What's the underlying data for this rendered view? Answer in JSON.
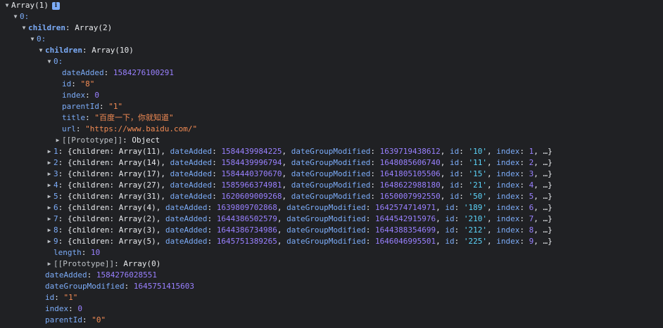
{
  "colors": {
    "background": "#202124",
    "key": "#7cacf8",
    "number": "#9980ff",
    "string": "#f28b54",
    "text": "#e8eaed",
    "info_badge": "#7cacf8"
  },
  "info_icon": "info-icon",
  "lines": [
    {
      "indent": 0,
      "arrow": "expanded",
      "clickable": true,
      "parts": [
        {
          "t": "plain",
          "v": "Array(1)"
        }
      ],
      "badge": "i"
    },
    {
      "indent": 1,
      "arrow": "expanded",
      "clickable": true,
      "parts": [
        {
          "t": "key",
          "v": "0:"
        }
      ]
    },
    {
      "indent": 2,
      "arrow": "expanded",
      "clickable": true,
      "parts": [
        {
          "t": "keyb",
          "v": "children"
        },
        {
          "t": "plain",
          "v": ": Array(2)"
        }
      ]
    },
    {
      "indent": 3,
      "arrow": "expanded",
      "clickable": true,
      "parts": [
        {
          "t": "key",
          "v": "0:"
        }
      ]
    },
    {
      "indent": 4,
      "arrow": "expanded",
      "clickable": true,
      "parts": [
        {
          "t": "keyb",
          "v": "children"
        },
        {
          "t": "plain",
          "v": ": Array(10)"
        }
      ]
    },
    {
      "indent": 5,
      "arrow": "expanded",
      "clickable": true,
      "parts": [
        {
          "t": "key",
          "v": "0:"
        }
      ]
    },
    {
      "indent": 6,
      "arrow": "none",
      "clickable": false,
      "parts": [
        {
          "t": "key",
          "v": "dateAdded"
        },
        {
          "t": "plain",
          "v": ": "
        },
        {
          "t": "num",
          "v": "1584276100291"
        }
      ]
    },
    {
      "indent": 6,
      "arrow": "none",
      "clickable": false,
      "parts": [
        {
          "t": "key",
          "v": "id"
        },
        {
          "t": "plain",
          "v": ": "
        },
        {
          "t": "str",
          "v": "\"8\""
        }
      ]
    },
    {
      "indent": 6,
      "arrow": "none",
      "clickable": false,
      "parts": [
        {
          "t": "key",
          "v": "index"
        },
        {
          "t": "plain",
          "v": ": "
        },
        {
          "t": "num",
          "v": "0"
        }
      ]
    },
    {
      "indent": 6,
      "arrow": "none",
      "clickable": false,
      "parts": [
        {
          "t": "key",
          "v": "parentId"
        },
        {
          "t": "plain",
          "v": ": "
        },
        {
          "t": "str",
          "v": "\"1\""
        }
      ]
    },
    {
      "indent": 6,
      "arrow": "none",
      "clickable": false,
      "parts": [
        {
          "t": "key",
          "v": "title"
        },
        {
          "t": "plain",
          "v": ": "
        },
        {
          "t": "str",
          "v": "\"百度一下，你就知道\""
        }
      ]
    },
    {
      "indent": 6,
      "arrow": "none",
      "clickable": false,
      "parts": [
        {
          "t": "key",
          "v": "url"
        },
        {
          "t": "plain",
          "v": ": "
        },
        {
          "t": "str",
          "v": "\"https://www.baidu.com/\""
        }
      ]
    },
    {
      "indent": 6,
      "arrow": "collapsed",
      "clickable": true,
      "parts": [
        {
          "t": "proto",
          "v": "[[Prototype]]"
        },
        {
          "t": "plain",
          "v": ": Object"
        }
      ]
    },
    {
      "indent": 5,
      "arrow": "collapsed",
      "clickable": true,
      "parts": [
        {
          "t": "key",
          "v": "1"
        },
        {
          "t": "plain",
          "v": ": {children: Array(11), "
        },
        {
          "t": "key",
          "v": "dateAdded"
        },
        {
          "t": "plain",
          "v": ": "
        },
        {
          "t": "num",
          "v": "1584439984225"
        },
        {
          "t": "plain",
          "v": ", "
        },
        {
          "t": "key",
          "v": "dateGroupModified"
        },
        {
          "t": "plain",
          "v": ": "
        },
        {
          "t": "num",
          "v": "1639719438612"
        },
        {
          "t": "plain",
          "v": ", "
        },
        {
          "t": "key",
          "v": "id"
        },
        {
          "t": "plain",
          "v": ": "
        },
        {
          "t": "strc",
          "v": "'10'"
        },
        {
          "t": "plain",
          "v": ", "
        },
        {
          "t": "key",
          "v": "index"
        },
        {
          "t": "plain",
          "v": ": "
        },
        {
          "t": "num",
          "v": "1"
        },
        {
          "t": "plain",
          "v": ", …}"
        }
      ]
    },
    {
      "indent": 5,
      "arrow": "collapsed",
      "clickable": true,
      "parts": [
        {
          "t": "key",
          "v": "2"
        },
        {
          "t": "plain",
          "v": ": {children: Array(14), "
        },
        {
          "t": "key",
          "v": "dateAdded"
        },
        {
          "t": "plain",
          "v": ": "
        },
        {
          "t": "num",
          "v": "1584439996794"
        },
        {
          "t": "plain",
          "v": ", "
        },
        {
          "t": "key",
          "v": "dateGroupModified"
        },
        {
          "t": "plain",
          "v": ": "
        },
        {
          "t": "num",
          "v": "1648085606740"
        },
        {
          "t": "plain",
          "v": ", "
        },
        {
          "t": "key",
          "v": "id"
        },
        {
          "t": "plain",
          "v": ": "
        },
        {
          "t": "strc",
          "v": "'11'"
        },
        {
          "t": "plain",
          "v": ", "
        },
        {
          "t": "key",
          "v": "index"
        },
        {
          "t": "plain",
          "v": ": "
        },
        {
          "t": "num",
          "v": "2"
        },
        {
          "t": "plain",
          "v": ", …}"
        }
      ]
    },
    {
      "indent": 5,
      "arrow": "collapsed",
      "clickable": true,
      "parts": [
        {
          "t": "key",
          "v": "3"
        },
        {
          "t": "plain",
          "v": ": {children: Array(17), "
        },
        {
          "t": "key",
          "v": "dateAdded"
        },
        {
          "t": "plain",
          "v": ": "
        },
        {
          "t": "num",
          "v": "1584440370670"
        },
        {
          "t": "plain",
          "v": ", "
        },
        {
          "t": "key",
          "v": "dateGroupModified"
        },
        {
          "t": "plain",
          "v": ": "
        },
        {
          "t": "num",
          "v": "1641805105506"
        },
        {
          "t": "plain",
          "v": ", "
        },
        {
          "t": "key",
          "v": "id"
        },
        {
          "t": "plain",
          "v": ": "
        },
        {
          "t": "strc",
          "v": "'15'"
        },
        {
          "t": "plain",
          "v": ", "
        },
        {
          "t": "key",
          "v": "index"
        },
        {
          "t": "plain",
          "v": ": "
        },
        {
          "t": "num",
          "v": "3"
        },
        {
          "t": "plain",
          "v": ", …}"
        }
      ]
    },
    {
      "indent": 5,
      "arrow": "collapsed",
      "clickable": true,
      "parts": [
        {
          "t": "key",
          "v": "4"
        },
        {
          "t": "plain",
          "v": ": {children: Array(27), "
        },
        {
          "t": "key",
          "v": "dateAdded"
        },
        {
          "t": "plain",
          "v": ": "
        },
        {
          "t": "num",
          "v": "1585966374981"
        },
        {
          "t": "plain",
          "v": ", "
        },
        {
          "t": "key",
          "v": "dateGroupModified"
        },
        {
          "t": "plain",
          "v": ": "
        },
        {
          "t": "num",
          "v": "1648622988180"
        },
        {
          "t": "plain",
          "v": ", "
        },
        {
          "t": "key",
          "v": "id"
        },
        {
          "t": "plain",
          "v": ": "
        },
        {
          "t": "strc",
          "v": "'21'"
        },
        {
          "t": "plain",
          "v": ", "
        },
        {
          "t": "key",
          "v": "index"
        },
        {
          "t": "plain",
          "v": ": "
        },
        {
          "t": "num",
          "v": "4"
        },
        {
          "t": "plain",
          "v": ", …}"
        }
      ]
    },
    {
      "indent": 5,
      "arrow": "collapsed",
      "clickable": true,
      "parts": [
        {
          "t": "key",
          "v": "5"
        },
        {
          "t": "plain",
          "v": ": {children: Array(31), "
        },
        {
          "t": "key",
          "v": "dateAdded"
        },
        {
          "t": "plain",
          "v": ": "
        },
        {
          "t": "num",
          "v": "1620609009268"
        },
        {
          "t": "plain",
          "v": ", "
        },
        {
          "t": "key",
          "v": "dateGroupModified"
        },
        {
          "t": "plain",
          "v": ": "
        },
        {
          "t": "num",
          "v": "1650007992550"
        },
        {
          "t": "plain",
          "v": ", "
        },
        {
          "t": "key",
          "v": "id"
        },
        {
          "t": "plain",
          "v": ": "
        },
        {
          "t": "strc",
          "v": "'50'"
        },
        {
          "t": "plain",
          "v": ", "
        },
        {
          "t": "key",
          "v": "index"
        },
        {
          "t": "plain",
          "v": ": "
        },
        {
          "t": "num",
          "v": "5"
        },
        {
          "t": "plain",
          "v": ", …}"
        }
      ]
    },
    {
      "indent": 5,
      "arrow": "collapsed",
      "clickable": true,
      "parts": [
        {
          "t": "key",
          "v": "6"
        },
        {
          "t": "plain",
          "v": ": {children: Array(4), "
        },
        {
          "t": "key",
          "v": "dateAdded"
        },
        {
          "t": "plain",
          "v": ": "
        },
        {
          "t": "num",
          "v": "1639809702868"
        },
        {
          "t": "plain",
          "v": ", "
        },
        {
          "t": "key",
          "v": "dateGroupModified"
        },
        {
          "t": "plain",
          "v": ": "
        },
        {
          "t": "num",
          "v": "1642574714971"
        },
        {
          "t": "plain",
          "v": ", "
        },
        {
          "t": "key",
          "v": "id"
        },
        {
          "t": "plain",
          "v": ": "
        },
        {
          "t": "strc",
          "v": "'189'"
        },
        {
          "t": "plain",
          "v": ", "
        },
        {
          "t": "key",
          "v": "index"
        },
        {
          "t": "plain",
          "v": ": "
        },
        {
          "t": "num",
          "v": "6"
        },
        {
          "t": "plain",
          "v": ", …}"
        }
      ]
    },
    {
      "indent": 5,
      "arrow": "collapsed",
      "clickable": true,
      "parts": [
        {
          "t": "key",
          "v": "7"
        },
        {
          "t": "plain",
          "v": ": {children: Array(2), "
        },
        {
          "t": "key",
          "v": "dateAdded"
        },
        {
          "t": "plain",
          "v": ": "
        },
        {
          "t": "num",
          "v": "1644386502579"
        },
        {
          "t": "plain",
          "v": ", "
        },
        {
          "t": "key",
          "v": "dateGroupModified"
        },
        {
          "t": "plain",
          "v": ": "
        },
        {
          "t": "num",
          "v": "1644542915976"
        },
        {
          "t": "plain",
          "v": ", "
        },
        {
          "t": "key",
          "v": "id"
        },
        {
          "t": "plain",
          "v": ": "
        },
        {
          "t": "strc",
          "v": "'210'"
        },
        {
          "t": "plain",
          "v": ", "
        },
        {
          "t": "key",
          "v": "index"
        },
        {
          "t": "plain",
          "v": ": "
        },
        {
          "t": "num",
          "v": "7"
        },
        {
          "t": "plain",
          "v": ", …}"
        }
      ]
    },
    {
      "indent": 5,
      "arrow": "collapsed",
      "clickable": true,
      "parts": [
        {
          "t": "key",
          "v": "8"
        },
        {
          "t": "plain",
          "v": ": {children: Array(3), "
        },
        {
          "t": "key",
          "v": "dateAdded"
        },
        {
          "t": "plain",
          "v": ": "
        },
        {
          "t": "num",
          "v": "1644386734986"
        },
        {
          "t": "plain",
          "v": ", "
        },
        {
          "t": "key",
          "v": "dateGroupModified"
        },
        {
          "t": "plain",
          "v": ": "
        },
        {
          "t": "num",
          "v": "1644388354699"
        },
        {
          "t": "plain",
          "v": ", "
        },
        {
          "t": "key",
          "v": "id"
        },
        {
          "t": "plain",
          "v": ": "
        },
        {
          "t": "strc",
          "v": "'212'"
        },
        {
          "t": "plain",
          "v": ", "
        },
        {
          "t": "key",
          "v": "index"
        },
        {
          "t": "plain",
          "v": ": "
        },
        {
          "t": "num",
          "v": "8"
        },
        {
          "t": "plain",
          "v": ", …}"
        }
      ]
    },
    {
      "indent": 5,
      "arrow": "collapsed",
      "clickable": true,
      "parts": [
        {
          "t": "key",
          "v": "9"
        },
        {
          "t": "plain",
          "v": ": {children: Array(5), "
        },
        {
          "t": "key",
          "v": "dateAdded"
        },
        {
          "t": "plain",
          "v": ": "
        },
        {
          "t": "num",
          "v": "1645751389265"
        },
        {
          "t": "plain",
          "v": ", "
        },
        {
          "t": "key",
          "v": "dateGroupModified"
        },
        {
          "t": "plain",
          "v": ": "
        },
        {
          "t": "num",
          "v": "1646046995501"
        },
        {
          "t": "plain",
          "v": ", "
        },
        {
          "t": "key",
          "v": "id"
        },
        {
          "t": "plain",
          "v": ": "
        },
        {
          "t": "strc",
          "v": "'225'"
        },
        {
          "t": "plain",
          "v": ", "
        },
        {
          "t": "key",
          "v": "index"
        },
        {
          "t": "plain",
          "v": ": "
        },
        {
          "t": "num",
          "v": "9"
        },
        {
          "t": "plain",
          "v": ", …}"
        }
      ]
    },
    {
      "indent": 5,
      "arrow": "none",
      "clickable": false,
      "parts": [
        {
          "t": "key",
          "v": "length"
        },
        {
          "t": "plain",
          "v": ": "
        },
        {
          "t": "num",
          "v": "10"
        }
      ]
    },
    {
      "indent": 5,
      "arrow": "collapsed",
      "clickable": true,
      "parts": [
        {
          "t": "proto",
          "v": "[[Prototype]]"
        },
        {
          "t": "plain",
          "v": ": Array(0)"
        }
      ]
    },
    {
      "indent": 4,
      "arrow": "none",
      "clickable": false,
      "parts": [
        {
          "t": "key",
          "v": "dateAdded"
        },
        {
          "t": "plain",
          "v": ": "
        },
        {
          "t": "num",
          "v": "1584276028551"
        }
      ]
    },
    {
      "indent": 4,
      "arrow": "none",
      "clickable": false,
      "parts": [
        {
          "t": "key",
          "v": "dateGroupModified"
        },
        {
          "t": "plain",
          "v": ": "
        },
        {
          "t": "num",
          "v": "1645751415603"
        }
      ]
    },
    {
      "indent": 4,
      "arrow": "none",
      "clickable": false,
      "parts": [
        {
          "t": "key",
          "v": "id"
        },
        {
          "t": "plain",
          "v": ": "
        },
        {
          "t": "str",
          "v": "\"1\""
        }
      ]
    },
    {
      "indent": 4,
      "arrow": "none",
      "clickable": false,
      "parts": [
        {
          "t": "key",
          "v": "index"
        },
        {
          "t": "plain",
          "v": ": "
        },
        {
          "t": "num",
          "v": "0"
        }
      ]
    },
    {
      "indent": 4,
      "arrow": "none",
      "clickable": false,
      "parts": [
        {
          "t": "key",
          "v": "parentId"
        },
        {
          "t": "plain",
          "v": ": "
        },
        {
          "t": "str",
          "v": "\"0\""
        }
      ]
    }
  ]
}
